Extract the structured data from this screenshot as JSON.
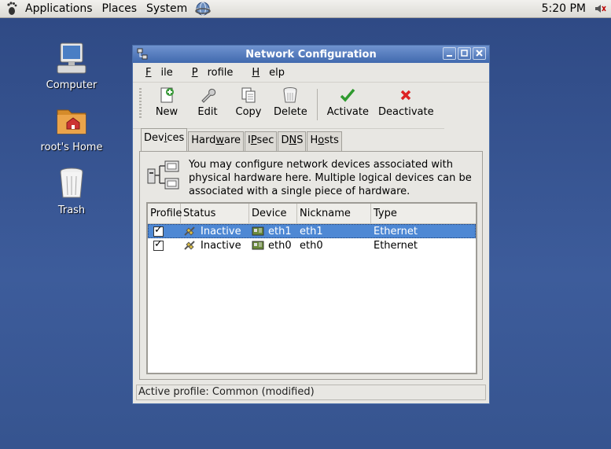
{
  "panel": {
    "menus": [
      "Applications",
      "Places",
      "System"
    ],
    "clock": "5:20 PM"
  },
  "desktop": {
    "icons": [
      {
        "label": "Computer",
        "icon": "computer-icon"
      },
      {
        "label": "root's Home",
        "icon": "home-folder-icon"
      },
      {
        "label": "Trash",
        "icon": "trash-icon"
      }
    ]
  },
  "window": {
    "title": "Network Configuration",
    "menu": [
      "File",
      "Profile",
      "Help"
    ],
    "toolbar": [
      "New",
      "Edit",
      "Copy",
      "Delete",
      "Activate",
      "Deactivate"
    ],
    "tabs": [
      "Devices",
      "Hardware",
      "IPsec",
      "DNS",
      "Hosts"
    ],
    "active_tab": "Devices",
    "info_text": "You may configure network devices associated with physical hardware here.  Multiple logical devices can be associated with a single piece of hardware.",
    "columns": [
      "Profile",
      "Status",
      "Device",
      "Nickname",
      "Type"
    ],
    "rows": [
      {
        "profile_checked": true,
        "status": "Inactive",
        "device": "eth1",
        "nickname": "eth1",
        "type": "Ethernet",
        "selected": true
      },
      {
        "profile_checked": true,
        "status": "Inactive",
        "device": "eth0",
        "nickname": "eth0",
        "type": "Ethernet",
        "selected": false
      }
    ],
    "status_bar": "Active profile: Common (modified)"
  }
}
